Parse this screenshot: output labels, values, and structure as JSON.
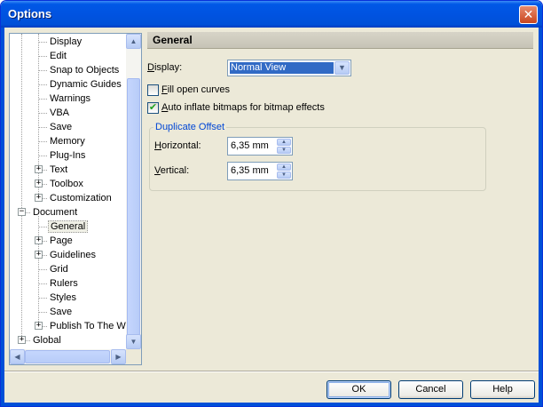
{
  "window": {
    "title": "Options"
  },
  "tree": {
    "items": [
      {
        "label": "Display",
        "level": 2,
        "expander": false,
        "selected": false
      },
      {
        "label": "Edit",
        "level": 2,
        "expander": false,
        "selected": false
      },
      {
        "label": "Snap to Objects",
        "level": 2,
        "expander": false,
        "selected": false
      },
      {
        "label": "Dynamic Guides",
        "level": 2,
        "expander": false,
        "selected": false
      },
      {
        "label": "Warnings",
        "level": 2,
        "expander": false,
        "selected": false
      },
      {
        "label": "VBA",
        "level": 2,
        "expander": false,
        "selected": false
      },
      {
        "label": "Save",
        "level": 2,
        "expander": false,
        "selected": false
      },
      {
        "label": "Memory",
        "level": 2,
        "expander": false,
        "selected": false
      },
      {
        "label": "Plug-Ins",
        "level": 2,
        "expander": false,
        "selected": false
      },
      {
        "label": "Text",
        "level": 2,
        "expander": "+",
        "selected": false
      },
      {
        "label": "Toolbox",
        "level": 2,
        "expander": "+",
        "selected": false
      },
      {
        "label": "Customization",
        "level": 2,
        "expander": "+",
        "selected": false
      },
      {
        "label": "Document",
        "level": 1,
        "expander": "−",
        "selected": false
      },
      {
        "label": "General",
        "level": 2,
        "expander": false,
        "selected": true
      },
      {
        "label": "Page",
        "level": 2,
        "expander": "+",
        "selected": false
      },
      {
        "label": "Guidelines",
        "level": 2,
        "expander": "+",
        "selected": false
      },
      {
        "label": "Grid",
        "level": 2,
        "expander": false,
        "selected": false
      },
      {
        "label": "Rulers",
        "level": 2,
        "expander": false,
        "selected": false
      },
      {
        "label": "Styles",
        "level": 2,
        "expander": false,
        "selected": false
      },
      {
        "label": "Save",
        "level": 2,
        "expander": false,
        "selected": false
      },
      {
        "label": "Publish To The We",
        "level": 2,
        "expander": "+",
        "selected": false
      },
      {
        "label": "Global",
        "level": 1,
        "expander": "+",
        "selected": false
      }
    ]
  },
  "general": {
    "header": "General",
    "display_label_prefix": "D",
    "display_label_rest": "isplay:",
    "display_value": "Normal View",
    "fill_open_curves": {
      "u": "F",
      "rest": "ill open curves",
      "checked": false
    },
    "auto_inflate": {
      "u": "A",
      "rest": "uto inflate bitmaps for bitmap effects",
      "checked": true
    },
    "duplicate_offset": {
      "title": "Duplicate Offset",
      "horizontal_u": "H",
      "horizontal_rest": "orizontal:",
      "horizontal_value": "6,35 mm",
      "vertical_u": "V",
      "vertical_rest": "ertical:",
      "vertical_value": "6,35 mm"
    }
  },
  "buttons": {
    "ok": "OK",
    "cancel": "Cancel",
    "help": "Help"
  },
  "colors": {
    "titlebar": "#0053e1",
    "selection": "#316ac5",
    "group_title": "#0046d5"
  },
  "icons": {
    "close": "close-icon",
    "scroll_up": "scroll-up-arrow-icon",
    "scroll_down": "scroll-down-arrow-icon",
    "scroll_left": "scroll-left-arrow-icon",
    "scroll_right": "scroll-right-arrow-icon",
    "dropdown": "chevron-down-icon",
    "checkmark": "check-icon"
  }
}
